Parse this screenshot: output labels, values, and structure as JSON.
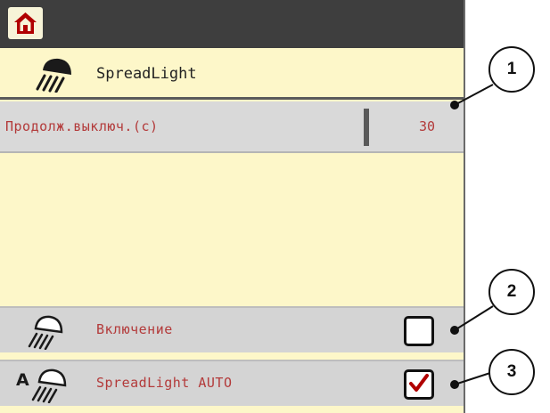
{
  "header": {
    "home_icon": "home-icon"
  },
  "title_row": {
    "icon": "spreadlight-lamp-icon",
    "title": "SpreadLight"
  },
  "parameter": {
    "label": "Продолж.выключ.(c)",
    "value": "30"
  },
  "toggles": [
    {
      "icon": "lamp-icon",
      "label": "Включение",
      "checked": false
    },
    {
      "icon": "auto-lamp-icon",
      "icon_text": "A",
      "label": "SpreadLight AUTO",
      "checked": true
    }
  ],
  "callouts": [
    "1",
    "2",
    "3"
  ],
  "colors": {
    "panel_bg": "#fdf7c9",
    "header_bg": "#3e3e3e",
    "row_bg": "#d9d9d9",
    "label_text": "#b33a3a",
    "home_red": "#b00000",
    "check_red": "#b00000"
  }
}
